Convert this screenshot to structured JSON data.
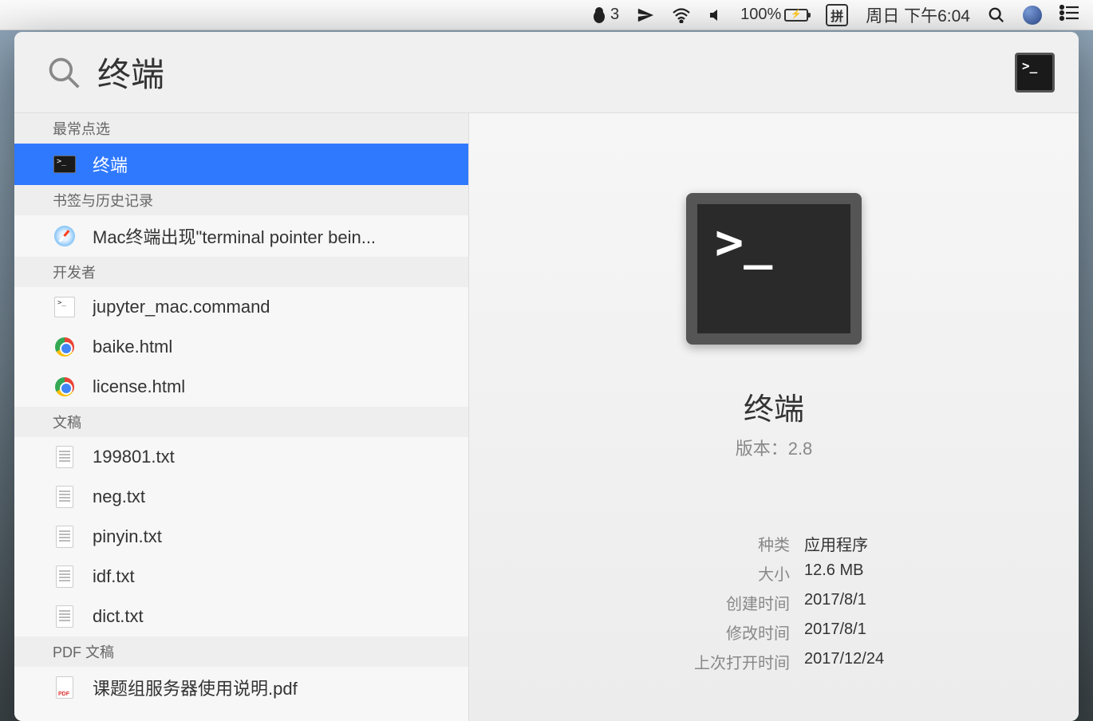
{
  "menubar": {
    "qq_badge": "3",
    "battery_percent": "100%",
    "input_method": "拼",
    "datetime": "周日 下午6:04"
  },
  "spotlight": {
    "search_query": "终端",
    "sections": [
      {
        "title": "最常点选",
        "items": [
          {
            "icon": "terminal",
            "label": "终端",
            "selected": true
          }
        ]
      },
      {
        "title": "书签与历史记录",
        "items": [
          {
            "icon": "safari",
            "label": "Mac终端出现\"terminal pointer bein...",
            "selected": false
          }
        ]
      },
      {
        "title": "开发者",
        "items": [
          {
            "icon": "cmd",
            "label": "jupyter_mac.command",
            "selected": false
          },
          {
            "icon": "chrome",
            "label": "baike.html",
            "selected": false
          },
          {
            "icon": "chrome",
            "label": "license.html",
            "selected": false
          }
        ]
      },
      {
        "title": "文稿",
        "items": [
          {
            "icon": "txt",
            "label": "199801.txt",
            "selected": false
          },
          {
            "icon": "txt",
            "label": "neg.txt",
            "selected": false
          },
          {
            "icon": "txt",
            "label": "pinyin.txt",
            "selected": false
          },
          {
            "icon": "txt",
            "label": "idf.txt",
            "selected": false
          },
          {
            "icon": "txt",
            "label": "dict.txt",
            "selected": false
          }
        ]
      },
      {
        "title": "PDF 文稿",
        "items": [
          {
            "icon": "pdf",
            "label": "课题组服务器使用说明.pdf",
            "selected": false
          }
        ]
      }
    ],
    "preview": {
      "title": "终端",
      "version_label": "版本：",
      "version_value": "2.8",
      "details": [
        {
          "label": "种类",
          "value": "应用程序"
        },
        {
          "label": "大小",
          "value": "12.6 MB"
        },
        {
          "label": "创建时间",
          "value": "2017/8/1"
        },
        {
          "label": "修改时间",
          "value": "2017/8/1"
        },
        {
          "label": "上次打开时间",
          "value": "2017/12/24"
        }
      ]
    }
  }
}
